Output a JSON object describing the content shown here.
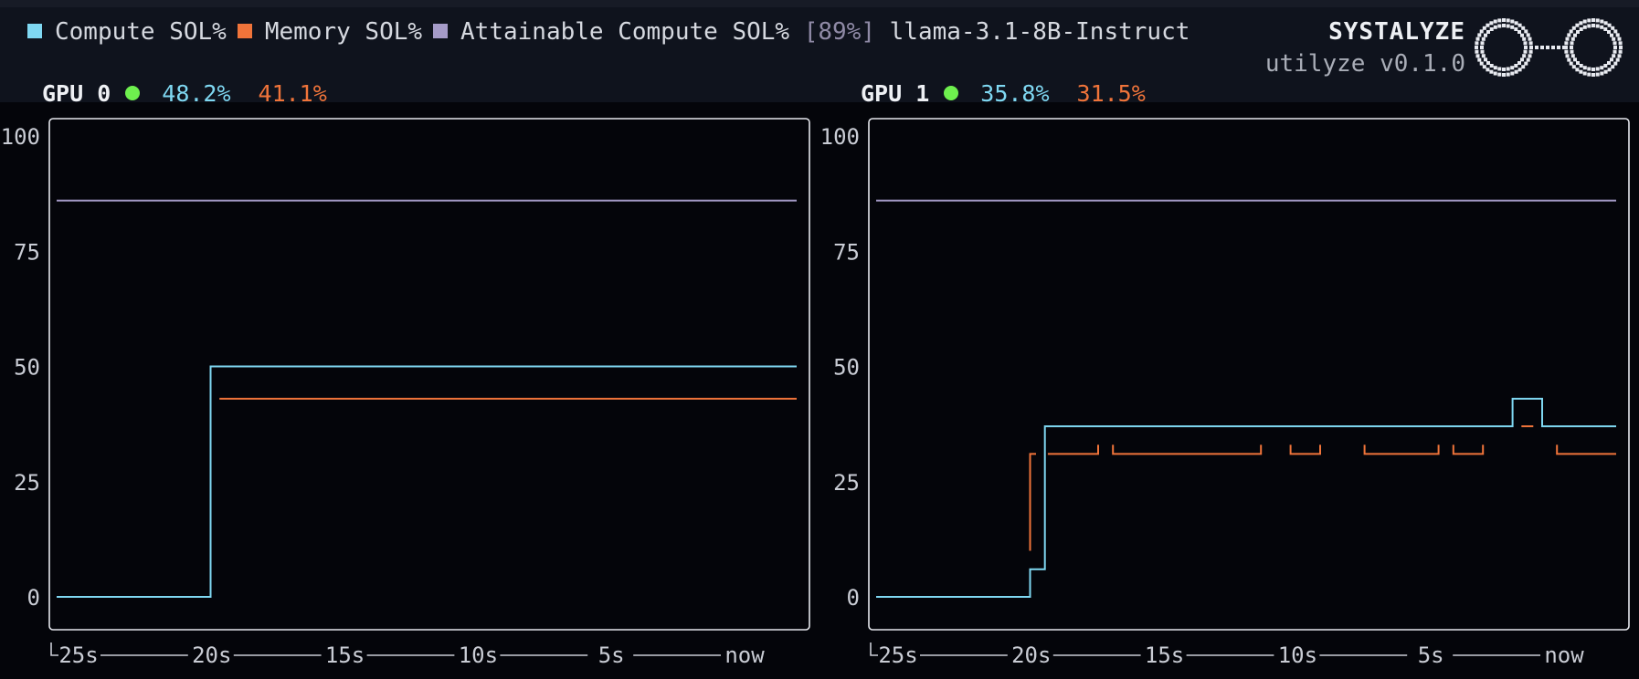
{
  "legend": {
    "compute_label": "Compute SOL%",
    "memory_label": "Memory SOL%",
    "attainable_label": "Attainable Compute SOL%",
    "attainable_value": "[89%]",
    "model": "llama-3.1-8B-Instruct"
  },
  "brand": {
    "name": "SYSTALYZE",
    "version": "utilyze v0.1.0"
  },
  "colors": {
    "compute": "#7fd8f2",
    "memory": "#f0743a",
    "attainable": "#a59bc8",
    "status_ok": "#6ef04e"
  },
  "gpus": [
    {
      "name": "GPU 0",
      "compute": "48.2%",
      "memory": "41.1%"
    },
    {
      "name": "GPU 1",
      "compute": "35.8%",
      "memory": "31.5%"
    }
  ],
  "chart_data": [
    {
      "type": "line",
      "title": "GPU 0",
      "x_tick_labels": [
        "25s",
        "20s",
        "15s",
        "10s",
        "5s",
        "now"
      ],
      "y_tick_labels": [
        "0",
        "25",
        "50",
        "75",
        "100"
      ],
      "ylim": [
        0,
        100
      ],
      "xlim": [
        -25,
        0
      ],
      "series": [
        {
          "name": "Compute SOL%",
          "segments": [
            [
              [
                -25,
                0
              ],
              [
                -19.8,
                0
              ],
              [
                -19.8,
                50
              ],
              [
                0,
                50
              ]
            ]
          ]
        },
        {
          "name": "Memory SOL%",
          "segments": [
            [
              [
                -19.5,
                43
              ],
              [
                0,
                43
              ]
            ]
          ]
        },
        {
          "name": "Attainable Compute SOL%",
          "segments": [
            [
              [
                -25,
                86
              ],
              [
                0,
                86
              ]
            ]
          ]
        }
      ]
    },
    {
      "type": "line",
      "title": "GPU 1",
      "x_tick_labels": [
        "25s",
        "20s",
        "15s",
        "10s",
        "5s",
        "now"
      ],
      "y_tick_labels": [
        "0",
        "25",
        "50",
        "75",
        "100"
      ],
      "ylim": [
        0,
        100
      ],
      "xlim": [
        -25,
        0
      ],
      "series": [
        {
          "name": "Compute SOL%",
          "segments": [
            [
              [
                -25,
                0
              ],
              [
                -19.8,
                0
              ],
              [
                -19.8,
                6
              ],
              [
                -19.3,
                6
              ],
              [
                -19.3,
                37
              ],
              [
                -3.5,
                37
              ],
              [
                -3.5,
                43
              ],
              [
                -2.5,
                43
              ],
              [
                -2.5,
                37
              ],
              [
                0,
                37
              ]
            ]
          ]
        },
        {
          "name": "Memory SOL%",
          "segments": [
            [
              [
                -19.8,
                10
              ],
              [
                -19.8,
                31
              ],
              [
                -19.6,
                31
              ]
            ],
            [
              [
                -19.2,
                31
              ],
              [
                -17.5,
                31
              ],
              [
                -17.5,
                33
              ]
            ],
            [
              [
                -17,
                33
              ],
              [
                -17,
                31
              ],
              [
                -12,
                31
              ],
              [
                -12,
                33
              ]
            ],
            [
              [
                -11,
                33
              ],
              [
                -11,
                31
              ],
              [
                -10,
                31
              ],
              [
                -10,
                33
              ]
            ],
            [
              [
                -8.5,
                33
              ],
              [
                -8.5,
                31
              ],
              [
                -6,
                31
              ],
              [
                -6,
                33
              ]
            ],
            [
              [
                -5.5,
                33
              ],
              [
                -5.5,
                31
              ],
              [
                -4.5,
                31
              ],
              [
                -4.5,
                33
              ]
            ],
            [
              [
                -3.2,
                37
              ],
              [
                -2.8,
                37
              ]
            ],
            [
              [
                -2,
                33
              ],
              [
                -2,
                31
              ],
              [
                0,
                31
              ]
            ]
          ]
        },
        {
          "name": "Attainable Compute SOL%",
          "segments": [
            [
              [
                -25,
                86
              ],
              [
                0,
                86
              ]
            ]
          ]
        }
      ]
    }
  ]
}
